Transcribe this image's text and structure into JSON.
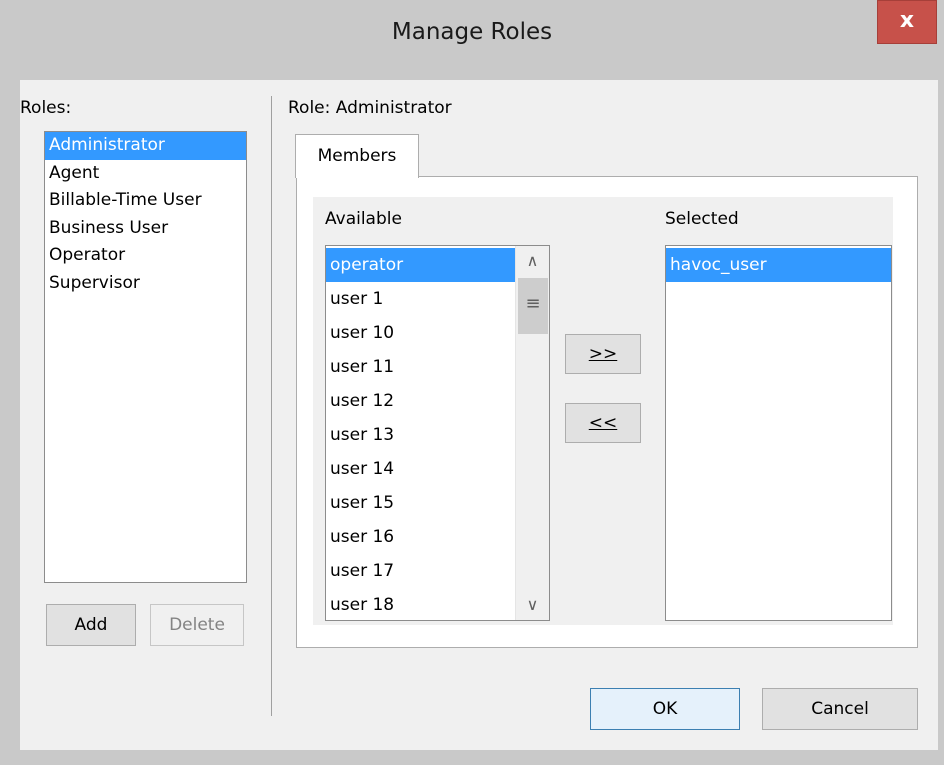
{
  "window": {
    "title": "Manage Roles",
    "close_label": "x"
  },
  "roles": {
    "label": "Roles:",
    "items": [
      "Administrator",
      "Agent",
      "Billable-Time User",
      "Business User",
      "Operator",
      "Supervisor"
    ],
    "selected": "Administrator",
    "add_label": "Add",
    "delete_label": "Delete"
  },
  "role_panel": {
    "heading": "Role: Administrator",
    "tab_label": "Members",
    "available_label": "Available",
    "available_items": [
      "operator",
      "user 1",
      "user 10",
      "user 11",
      "user 12",
      "user 13",
      "user 14",
      "user 15",
      "user 16",
      "user 17",
      "user 18"
    ],
    "available_selected": "operator",
    "selected_label": "Selected",
    "selected_items": [
      "havoc_user"
    ],
    "add_member_label": ">>",
    "remove_member_label": "<<"
  },
  "footer": {
    "ok_label": "OK",
    "cancel_label": "Cancel"
  },
  "colors": {
    "selection": "#3399ff",
    "close_button": "#c7514a"
  }
}
